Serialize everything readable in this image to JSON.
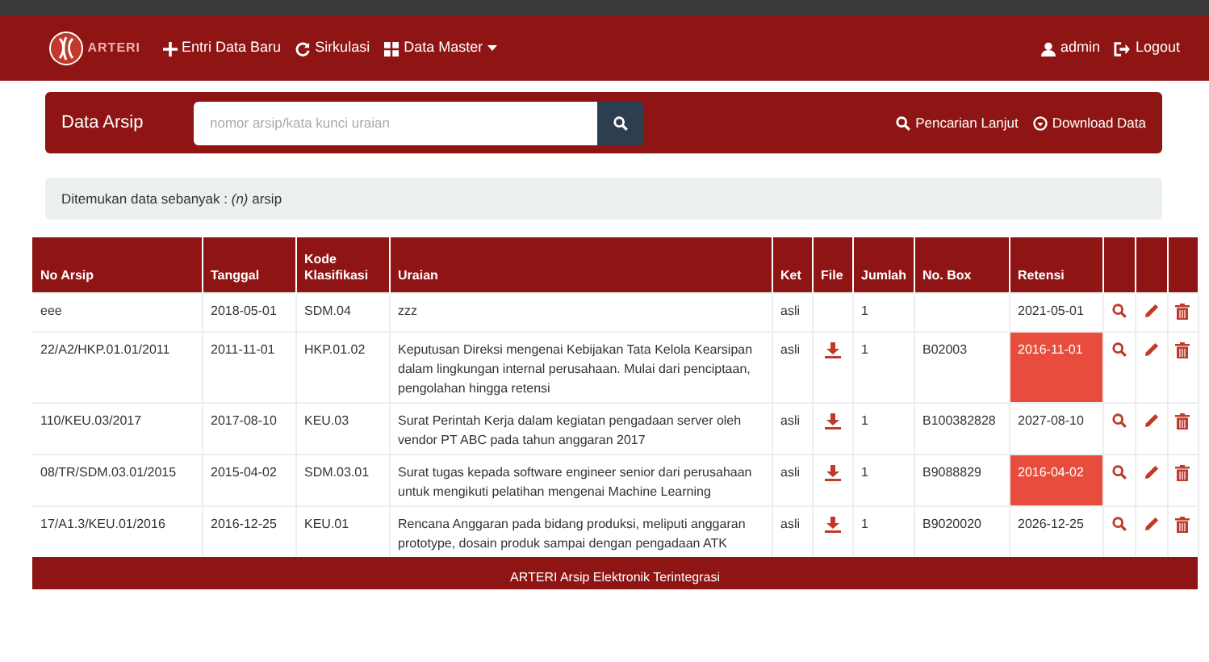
{
  "navbar": {
    "logo_text": "ARTERI",
    "items": [
      {
        "label": "Entri Data Baru",
        "dropdown": false
      },
      {
        "label": "Sirkulasi",
        "dropdown": false
      },
      {
        "label": "Data Master",
        "dropdown": true
      }
    ],
    "right_items": [
      {
        "label": "admin"
      },
      {
        "label": "Logout"
      }
    ]
  },
  "search_panel": {
    "title": "Data Arsip",
    "placeholder": "nomor arsip/kata kunci uraian",
    "links": [
      {
        "label": "Pencarian Lanjut"
      },
      {
        "label": "Download Data"
      }
    ]
  },
  "info": "Ditemukan data sebanyak : *(n)* arsip",
  "table": {
    "columns": [
      {
        "label": "No Arsip"
      },
      {
        "label": "Tanggal"
      },
      {
        "label": "Kode Klasifikasi"
      },
      {
        "label": "Uraian"
      },
      {
        "label": "Ket"
      },
      {
        "label": "File"
      },
      {
        "label": "Jumlah"
      },
      {
        "label": "No. Box"
      },
      {
        "label": "Retensi"
      }
    ],
    "rows": [
      {
        "no_arsip": "eee",
        "tanggal": "2018-05-01",
        "kode": "SDM.04",
        "uraian": "zzz",
        "ket": "asli",
        "has_file": false,
        "jumlah": "1",
        "no_box": "",
        "retensi": "2021-05-01",
        "expired": false
      },
      {
        "no_arsip": "22/A2/HKP.01.01/2011",
        "tanggal": "2011-11-01",
        "kode": "HKP.01.02",
        "uraian": "Keputusan Direksi mengenai Kebijakan Tata Kelola Kearsipan dalam lingkungan internal perusahaan. Mulai dari penciptaan, pengolahan hingga retensi",
        "ket": "asli",
        "has_file": true,
        "jumlah": "1",
        "no_box": "B02003",
        "retensi": "2016-11-01",
        "expired": true
      },
      {
        "no_arsip": "110/KEU.03/2017",
        "tanggal": "2017-08-10",
        "kode": "KEU.03",
        "uraian": "Surat Perintah Kerja dalam kegiatan pengadaan server oleh vendor PT ABC pada tahun anggaran 2017",
        "ket": "asli",
        "has_file": true,
        "jumlah": "1",
        "no_box": "B100382828",
        "retensi": "2027-08-10",
        "expired": false
      },
      {
        "no_arsip": "08/TR/SDM.03.01/2015",
        "tanggal": "2015-04-02",
        "kode": "SDM.03.01",
        "uraian": "Surat tugas kepada software engineer senior dari perusahaan untuk mengikuti pelatihan mengenai Machine Learning",
        "ket": "asli",
        "has_file": true,
        "jumlah": "1",
        "no_box": "B9088829",
        "retensi": "2016-04-02",
        "expired": true
      },
      {
        "no_arsip": "17/A1.3/KEU.01/2016",
        "tanggal": "2016-12-25",
        "kode": "KEU.01",
        "uraian": "Rencana Anggaran pada bidang produksi, meliputi anggaran prototype, dosain produk sampai dengan pengadaan ATK",
        "ket": "asli",
        "has_file": true,
        "jumlah": "1",
        "no_box": "B9020020",
        "retensi": "2026-12-25",
        "expired": false
      }
    ]
  },
  "footer": "ARTERI Arsip Elektronik Terintegrasi"
}
